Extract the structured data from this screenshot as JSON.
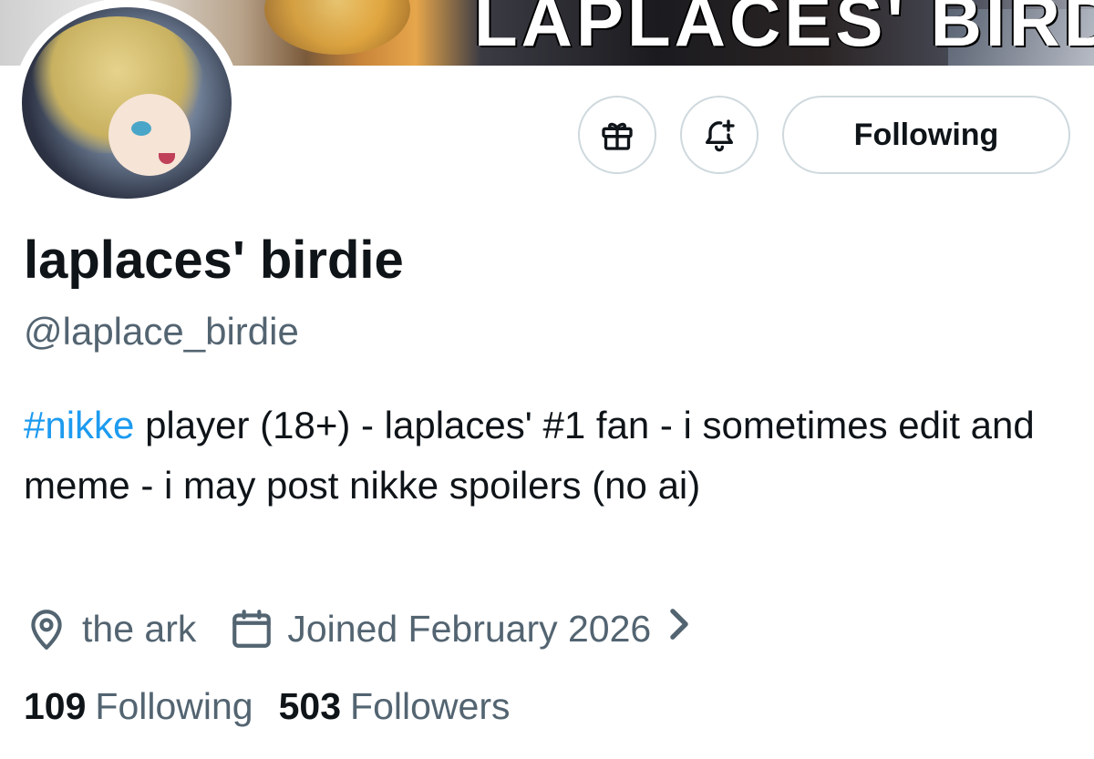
{
  "banner": {
    "title": "LAPLACES' BIRDIE"
  },
  "actions": {
    "gift_icon": "gift-icon",
    "notify_icon": "bell-plus-icon",
    "follow_label": "Following"
  },
  "profile": {
    "display_name": "laplaces' birdie",
    "handle": "@laplace_birdie",
    "bio_hashtag": "#nikke",
    "bio_text": " player (18+) - laplaces' #1 fan - i sometimes edit and meme - i may post nikke spoilers (no ai)",
    "location": "the ark",
    "joined": "Joined February 2026"
  },
  "stats": {
    "following_count": "109",
    "following_label": "Following",
    "followers_count": "503",
    "followers_label": "Followers"
  },
  "colors": {
    "accent": "#1d9bf0",
    "text_primary": "#0f1419",
    "text_secondary": "#536471",
    "border": "#cfd9de"
  }
}
